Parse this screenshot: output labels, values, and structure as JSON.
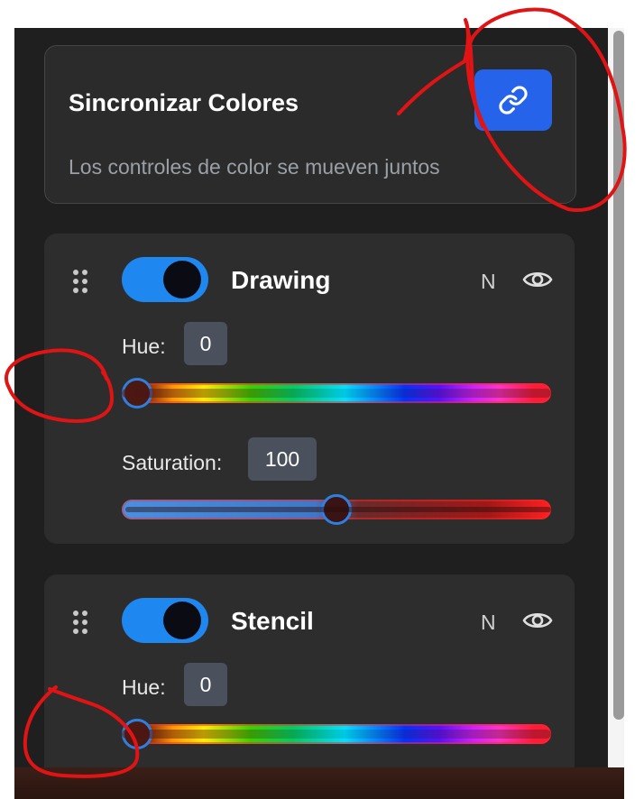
{
  "sync": {
    "title": "Sincronizar Colores",
    "description": "Los controles de color se mueven juntos",
    "button_icon": "link-icon"
  },
  "layers": [
    {
      "name": "Drawing",
      "enabled": true,
      "blend_mode": "N",
      "visible": true,
      "hue_label": "Hue:",
      "hue_value": "0",
      "saturation_label": "Saturation:",
      "saturation_value": "100",
      "saturation_slider_level": 0.5
    },
    {
      "name": "Stencil",
      "enabled": true,
      "blend_mode": "N",
      "visible": true,
      "hue_label": "Hue:",
      "hue_value": "0"
    }
  ],
  "colors": {
    "accent": "#2563eb",
    "toggle_on": "#1e88f0",
    "annotation": "#e01414"
  }
}
